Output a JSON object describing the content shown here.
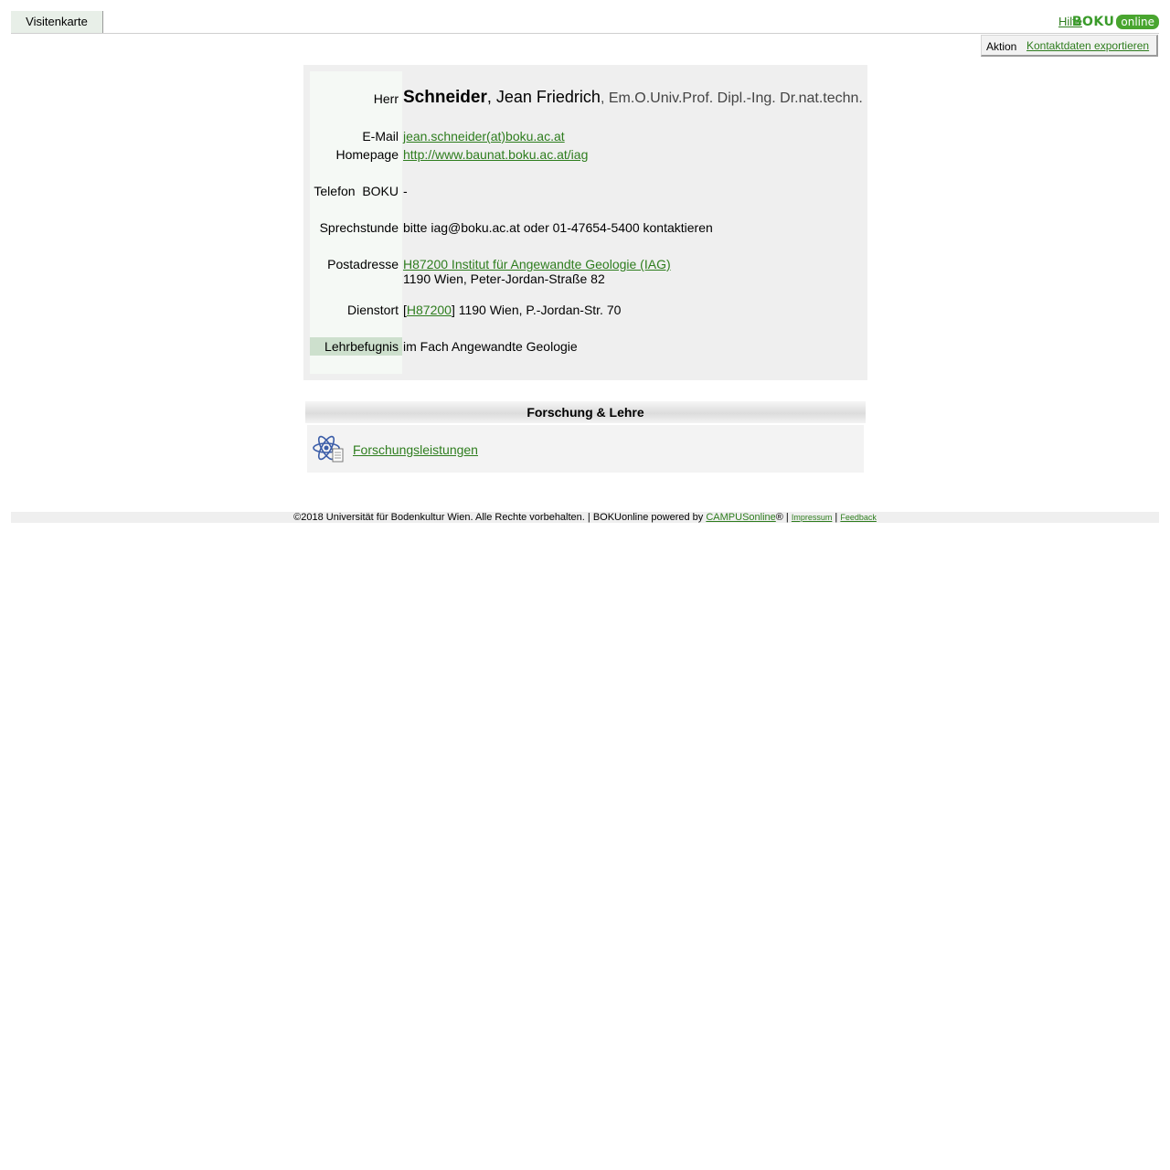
{
  "header": {
    "tab_label": "Visitenkarte",
    "help_label": "Hilfe",
    "logo_boku": "BOKU",
    "logo_online": "online"
  },
  "action": {
    "label": "Aktion",
    "link": "Kontaktdaten exportieren"
  },
  "card": {
    "salutation": "Herr",
    "family_name": "Schneider",
    "given_name": ", Jean Friedrich",
    "titles": ", Em.O.Univ.Prof. Dipl.-Ing. Dr.nat.techn.",
    "email_label": "E-Mail",
    "email": "jean.schneider(at)boku.ac.at",
    "homepage_label": "Homepage",
    "homepage": "http://www.baunat.boku.ac.at/iag",
    "phone_label": "Telefon  BOKU",
    "phone_value": "-",
    "office_hours_label": "Sprechstunde",
    "office_hours": "bitte iag@boku.ac.at oder 01-47654-5400 kontaktieren",
    "postal_label": "Postadresse",
    "postal_link": "H87200 Institut für Angewandte Geologie (IAG)",
    "postal_address": "1190 Wien, Peter-Jordan-Straße 82",
    "office_label": "Dienstort",
    "office_prefix": "[",
    "office_link": "H87200",
    "office_rest": "] 1190 Wien, P.-Jordan-Str. 70",
    "lehr_label": "Lehrbefugnis",
    "lehr_value": "im Fach Angewandte Geologie"
  },
  "research": {
    "header": "Forschung & Lehre",
    "link": "Forschungsleistungen"
  },
  "footer": {
    "copyright": "©2018 Universität für Bodenkultur Wien. Alle Rechte vorbehalten. | BOKUonline powered by ",
    "campus_link": "CAMPUSonline",
    "reg": "® | ",
    "impressum": "Impressum",
    "sep": " | ",
    "feedback": "Feedback"
  }
}
